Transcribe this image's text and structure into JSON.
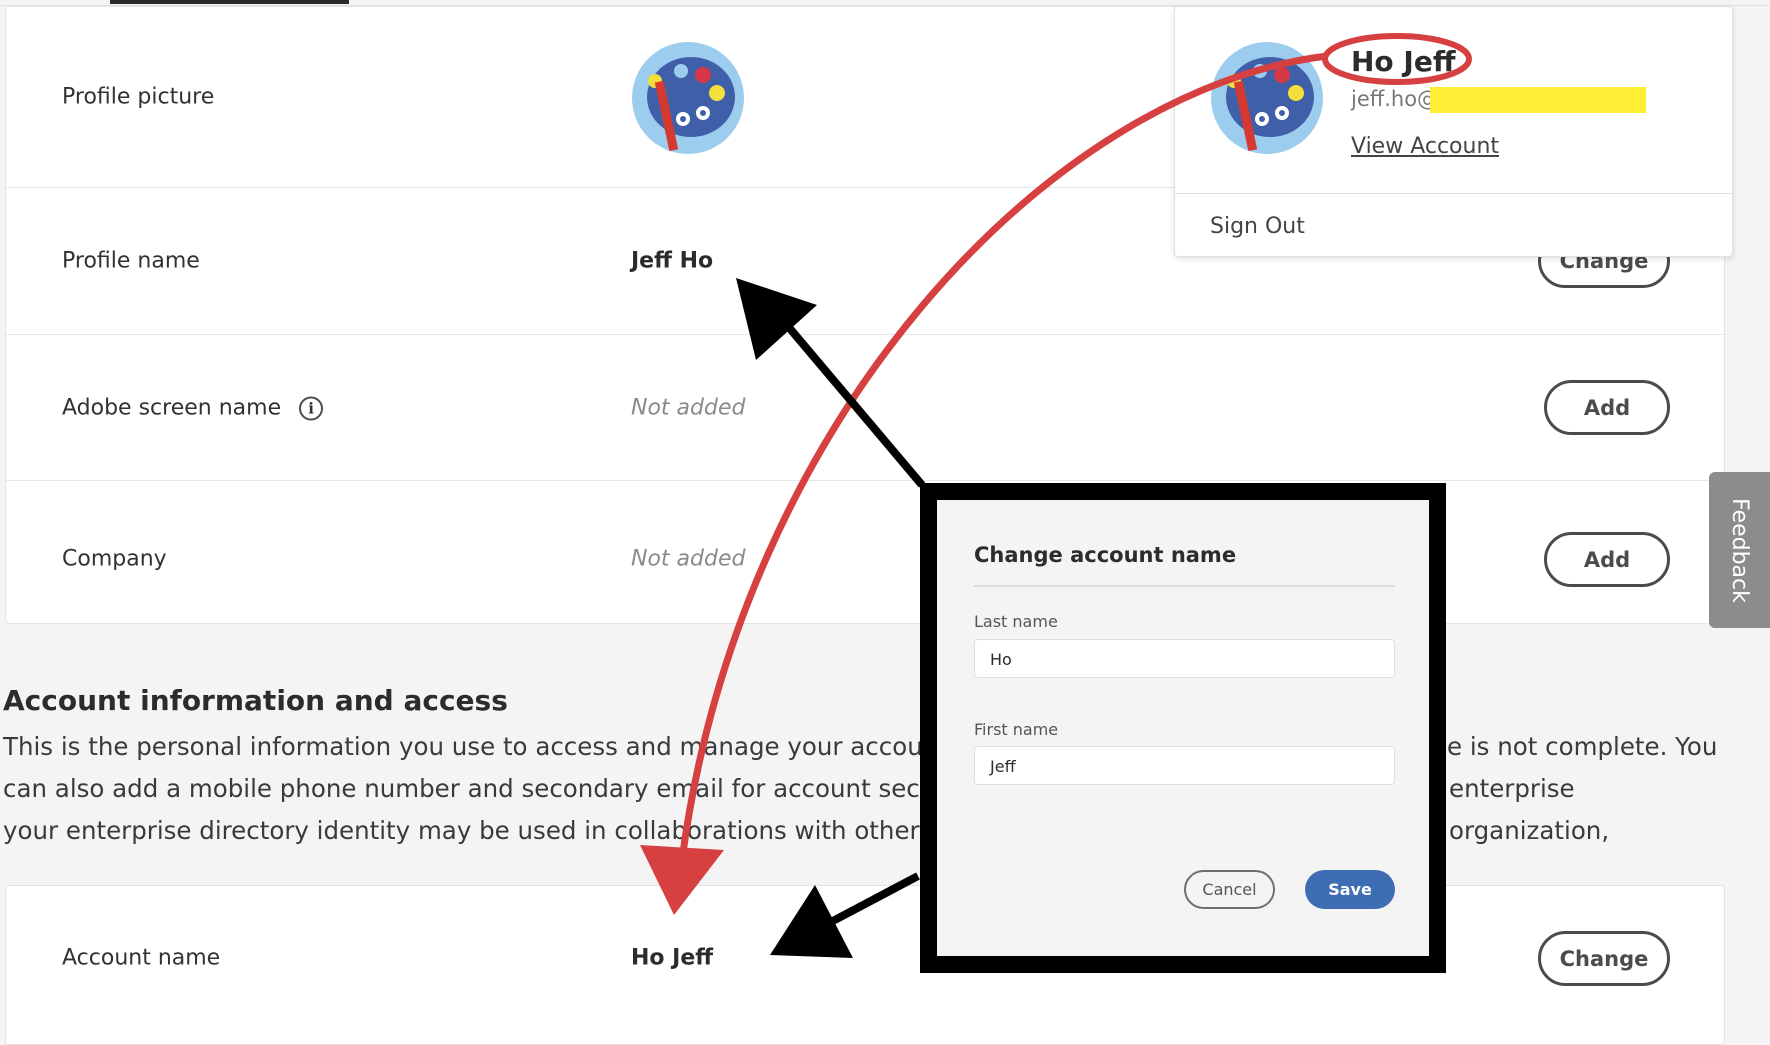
{
  "profile": {
    "rows": [
      {
        "label": "Profile picture"
      },
      {
        "label": "Profile name",
        "value": "Jeff Ho",
        "button": "Change"
      },
      {
        "label": "Adobe screen name",
        "value": "Not added",
        "button": "Add"
      },
      {
        "label": "Company",
        "value": "Not added",
        "button": "Add"
      }
    ]
  },
  "account": {
    "heading": "Account information and access",
    "lines": [
      "This is the personal information you use to access and manage your account. It w",
      "e is not complete. You",
      "can also add a mobile phone number and secondary email for account security, r",
      "enterprise organization,",
      "your enterprise directory identity may be used in collaborations with other meml"
    ],
    "row": {
      "label": "Account name",
      "value": "Ho Jeff",
      "button": "Change"
    }
  },
  "feedback": "Feedback",
  "dropdown": {
    "name": "Ho Jeff",
    "email": "jeff.ho@",
    "view_account": "View Account",
    "sign_out": "Sign Out",
    "redaction_color": "#ffee33"
  },
  "dialog": {
    "title": "Change account name",
    "last_label": "Last name",
    "last_value": "Ho",
    "first_label": "First name",
    "first_value": "Jeff",
    "cancel": "Cancel",
    "save": "Save",
    "save_color": "#3f6db4"
  },
  "annotations": {
    "red": "#d64040",
    "black": "#000000"
  }
}
